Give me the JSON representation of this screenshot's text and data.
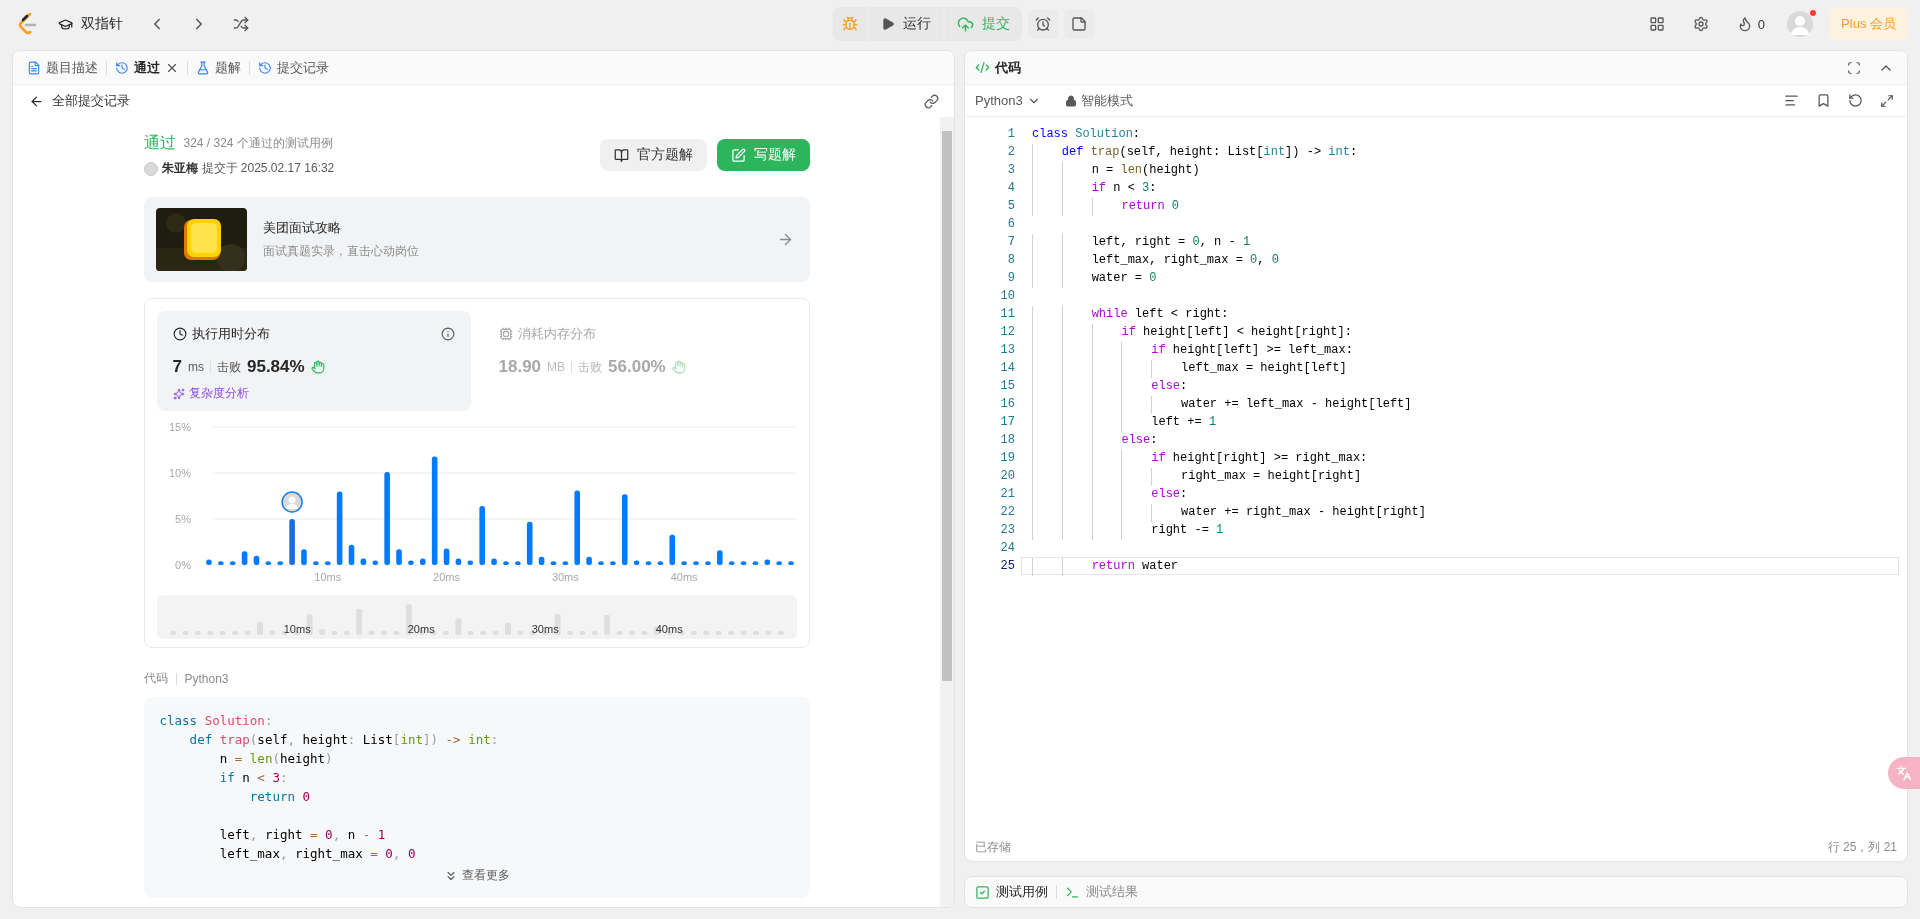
{
  "top_bar": {
    "problem": "双指针",
    "run": "运行",
    "submit": "提交",
    "fire_count": "0",
    "avatar_notification": true,
    "plus": "Plus 会员"
  },
  "left_tabs": [
    {
      "label": "题目描述",
      "kind": "doc",
      "selected": false,
      "closable": false
    },
    {
      "label": "通过",
      "kind": "history",
      "selected": true,
      "closable": true
    },
    {
      "label": "题解",
      "kind": "flask",
      "selected": false,
      "closable": false
    },
    {
      "label": "提交记录",
      "kind": "history",
      "selected": false,
      "closable": false
    }
  ],
  "back_link": "全部提交记录",
  "submission": {
    "status": "通过",
    "cases": "324 / 324 个通过的测试用例",
    "user": "朱亚梅",
    "submitted": "提交于 2025.02.17 16:32",
    "buttons": [
      {
        "label": "官方题解",
        "kind": "secondary"
      },
      {
        "label": "写题解",
        "kind": "primary"
      }
    ]
  },
  "promo": {
    "kind": "picture",
    "title": "美团面试攻略",
    "subtitle": "面试真题实录，直击心动岗位"
  },
  "stats": [
    {
      "kind": "time",
      "title": "执行用时分布",
      "selected": true,
      "value": "7",
      "unit": "ms",
      "beats_label": "击败",
      "beats": "95.84%",
      "extra": "复杂度分析"
    },
    {
      "kind": "memory",
      "title": "消耗内存分布",
      "selected": false,
      "value": "18.90",
      "unit": "MB",
      "beats_label": "击败",
      "beats": "56.00%"
    }
  ],
  "chart_data": {
    "type": "bar",
    "x": [
      0,
      1,
      2,
      3,
      4,
      5,
      6,
      7,
      8,
      9,
      10,
      11,
      12,
      13,
      14,
      15,
      16,
      17,
      18,
      19,
      20,
      21,
      22,
      23,
      24,
      25,
      26,
      27,
      28,
      29,
      30,
      31,
      32,
      33,
      34,
      35,
      36,
      37,
      38,
      39,
      40,
      41,
      42,
      43,
      44,
      45,
      46,
      47,
      48,
      49
    ],
    "values": [
      0.6,
      0.4,
      0.4,
      1.5,
      1.0,
      0.4,
      0.4,
      5.0,
      1.7,
      0.4,
      0.4,
      8.0,
      2.2,
      0.7,
      0.5,
      10.1,
      1.7,
      0.5,
      0.7,
      11.8,
      1.8,
      0.7,
      0.5,
      6.4,
      0.7,
      0.4,
      0.4,
      4.7,
      0.9,
      0.4,
      0.4,
      8.1,
      0.9,
      0.4,
      0.4,
      7.7,
      0.5,
      0.4,
      0.4,
      3.3,
      0.4,
      0.4,
      0.4,
      1.6,
      0.4,
      0.4,
      0.4,
      0.6,
      0.4,
      0.4
    ],
    "xlim": [
      -0.5,
      49.5
    ],
    "ylim": [
      0,
      15
    ],
    "yticks": [
      {
        "value": 0,
        "label": "0%"
      },
      {
        "value": 5,
        "label": "5%"
      },
      {
        "value": 10,
        "label": "10%"
      },
      {
        "value": 15,
        "label": "15%"
      }
    ],
    "xticks": [
      {
        "value": 10,
        "label": "10ms"
      },
      {
        "value": 20,
        "label": "20ms"
      },
      {
        "value": 30,
        "label": "30ms"
      },
      {
        "value": 40,
        "label": "40ms"
      }
    ]
  },
  "chart_overview": {
    "labels": [
      "10ms",
      "20ms",
      "30ms",
      "40ms"
    ]
  },
  "code_label": "代码",
  "code_lang": "Python3",
  "code_lines": [
    {
      "kind": "code",
      "tokens": [
        {
          "kind": "kw",
          "text": "class "
        },
        {
          "kind": "cls",
          "text": "Solution"
        },
        {
          "kind": "pu",
          "text": ":"
        }
      ]
    },
    {
      "kind": "code",
      "tokens": [
        {
          "kind": "kw",
          "text": "    def "
        },
        {
          "kind": "fn",
          "text": "trap"
        },
        {
          "kind": "pu",
          "text": "("
        },
        {
          "kind": "p",
          "text": "self"
        },
        {
          "kind": "pu",
          "text": ", "
        },
        {
          "kind": "p",
          "text": "height"
        },
        {
          "kind": "pu",
          "text": ": "
        },
        {
          "kind": "p",
          "text": "List"
        },
        {
          "kind": "pu",
          "text": "["
        },
        {
          "kind": "type",
          "text": "int"
        },
        {
          "kind": "pu",
          "text": "]) "
        },
        {
          "kind": "op",
          "text": "-> "
        },
        {
          "kind": "type",
          "text": "int"
        },
        {
          "kind": "pu",
          "text": ":"
        }
      ]
    },
    {
      "kind": "code",
      "tokens": [
        {
          "kind": "p",
          "text": "        n "
        },
        {
          "kind": "op",
          "text": "= "
        },
        {
          "kind": "call",
          "text": "len"
        },
        {
          "kind": "pu",
          "text": "("
        },
        {
          "kind": "p",
          "text": "height"
        },
        {
          "kind": "pu",
          "text": ")"
        }
      ]
    },
    {
      "kind": "code",
      "tokens": [
        {
          "kind": "ctl",
          "text": "        if "
        },
        {
          "kind": "p",
          "text": "n "
        },
        {
          "kind": "op",
          "text": "< "
        },
        {
          "kind": "num",
          "text": "3"
        },
        {
          "kind": "pu",
          "text": ":"
        }
      ]
    },
    {
      "kind": "code",
      "tokens": [
        {
          "kind": "ctl",
          "text": "            return "
        },
        {
          "kind": "num",
          "text": "0"
        }
      ]
    },
    {
      "kind": "blank"
    },
    {
      "kind": "code",
      "tokens": [
        {
          "kind": "p",
          "text": "        left"
        },
        {
          "kind": "pu",
          "text": ", "
        },
        {
          "kind": "p",
          "text": "right "
        },
        {
          "kind": "op",
          "text": "= "
        },
        {
          "kind": "num",
          "text": "0"
        },
        {
          "kind": "pu",
          "text": ", "
        },
        {
          "kind": "p",
          "text": "n "
        },
        {
          "kind": "op",
          "text": "- "
        },
        {
          "kind": "num",
          "text": "1"
        }
      ]
    },
    {
      "kind": "code",
      "tokens": [
        {
          "kind": "p",
          "text": "        left_max"
        },
        {
          "kind": "pu",
          "text": ", "
        },
        {
          "kind": "p",
          "text": "right_max "
        },
        {
          "kind": "op",
          "text": "= "
        },
        {
          "kind": "num",
          "text": "0"
        },
        {
          "kind": "pu",
          "text": ", "
        },
        {
          "kind": "num",
          "text": "0"
        }
      ]
    }
  ],
  "more": "查看更多",
  "editor": {
    "title": "代码",
    "language": "Python3",
    "mode": "智能模式",
    "saved": "已存储",
    "cursor": "行 25，列 21",
    "lines": [
      {
        "number": "1",
        "current": false,
        "kind": "code",
        "tokens": [
          {
            "kind": "kw",
            "text": "class "
          },
          {
            "kind": "cls",
            "text": "Solution"
          },
          {
            "kind": "pu",
            "text": ":"
          }
        ]
      },
      {
        "number": "2",
        "current": false,
        "kind": "code",
        "tokens": [
          {
            "kind": "kw",
            "text": "    def "
          },
          {
            "kind": "fn",
            "text": "trap"
          },
          {
            "kind": "pu",
            "text": "("
          },
          {
            "kind": "p",
            "text": "self"
          },
          {
            "kind": "pu",
            "text": ", "
          },
          {
            "kind": "p",
            "text": "height"
          },
          {
            "kind": "pu",
            "text": ": "
          },
          {
            "kind": "p",
            "text": "List"
          },
          {
            "kind": "pu",
            "text": "["
          },
          {
            "kind": "type",
            "text": "int"
          },
          {
            "kind": "pu",
            "text": "]) "
          },
          {
            "kind": "op",
            "text": "-> "
          },
          {
            "kind": "type",
            "text": "int"
          },
          {
            "kind": "pu",
            "text": ":"
          }
        ]
      },
      {
        "number": "3",
        "current": false,
        "kind": "code",
        "tokens": [
          {
            "kind": "p",
            "text": "        n "
          },
          {
            "kind": "op",
            "text": "= "
          },
          {
            "kind": "call",
            "text": "len"
          },
          {
            "kind": "pu",
            "text": "("
          },
          {
            "kind": "p",
            "text": "height"
          },
          {
            "kind": "pu",
            "text": ")"
          }
        ]
      },
      {
        "number": "4",
        "current": false,
        "kind": "code",
        "tokens": [
          {
            "kind": "ctl",
            "text": "        if "
          },
          {
            "kind": "p",
            "text": "n "
          },
          {
            "kind": "op",
            "text": "< "
          },
          {
            "kind": "num",
            "text": "3"
          },
          {
            "kind": "pu",
            "text": ":"
          }
        ]
      },
      {
        "number": "5",
        "current": false,
        "kind": "code",
        "tokens": [
          {
            "kind": "ctl",
            "text": "            return "
          },
          {
            "kind": "num",
            "text": "0"
          }
        ]
      },
      {
        "number": "6",
        "current": false,
        "kind": "blank"
      },
      {
        "number": "7",
        "current": false,
        "kind": "code",
        "tokens": [
          {
            "kind": "p",
            "text": "        left"
          },
          {
            "kind": "pu",
            "text": ", "
          },
          {
            "kind": "p",
            "text": "right "
          },
          {
            "kind": "op",
            "text": "= "
          },
          {
            "kind": "num",
            "text": "0"
          },
          {
            "kind": "pu",
            "text": ", "
          },
          {
            "kind": "p",
            "text": "n "
          },
          {
            "kind": "op",
            "text": "- "
          },
          {
            "kind": "num",
            "text": "1"
          }
        ]
      },
      {
        "number": "8",
        "current": false,
        "kind": "code",
        "tokens": [
          {
            "kind": "p",
            "text": "        left_max"
          },
          {
            "kind": "pu",
            "text": ", "
          },
          {
            "kind": "p",
            "text": "right_max "
          },
          {
            "kind": "op",
            "text": "= "
          },
          {
            "kind": "num",
            "text": "0"
          },
          {
            "kind": "pu",
            "text": ", "
          },
          {
            "kind": "num",
            "text": "0"
          }
        ]
      },
      {
        "number": "9",
        "current": false,
        "kind": "code",
        "tokens": [
          {
            "kind": "p",
            "text": "        water "
          },
          {
            "kind": "op",
            "text": "= "
          },
          {
            "kind": "num",
            "text": "0"
          }
        ]
      },
      {
        "number": "10",
        "current": false,
        "kind": "blank"
      },
      {
        "number": "11",
        "current": false,
        "kind": "code",
        "tokens": [
          {
            "kind": "ctl",
            "text": "        while "
          },
          {
            "kind": "p",
            "text": "left "
          },
          {
            "kind": "op",
            "text": "< "
          },
          {
            "kind": "p",
            "text": "right"
          },
          {
            "kind": "pu",
            "text": ":"
          }
        ]
      },
      {
        "number": "12",
        "current": false,
        "kind": "code",
        "tokens": [
          {
            "kind": "ctl",
            "text": "            if "
          },
          {
            "kind": "p",
            "text": "height[left] "
          },
          {
            "kind": "op",
            "text": "< "
          },
          {
            "kind": "p",
            "text": "height[right]"
          },
          {
            "kind": "pu",
            "text": ":"
          }
        ]
      },
      {
        "number": "13",
        "current": false,
        "kind": "code",
        "tokens": [
          {
            "kind": "ctl",
            "text": "                if "
          },
          {
            "kind": "p",
            "text": "height[left] "
          },
          {
            "kind": "op",
            "text": ">= "
          },
          {
            "kind": "p",
            "text": "left_max"
          },
          {
            "kind": "pu",
            "text": ":"
          }
        ]
      },
      {
        "number": "14",
        "current": false,
        "kind": "code",
        "tokens": [
          {
            "kind": "p",
            "text": "                    left_max "
          },
          {
            "kind": "op",
            "text": "= "
          },
          {
            "kind": "p",
            "text": "height[left]"
          }
        ]
      },
      {
        "number": "15",
        "current": false,
        "kind": "code",
        "tokens": [
          {
            "kind": "ctl",
            "text": "                else"
          },
          {
            "kind": "pu",
            "text": ":"
          }
        ]
      },
      {
        "number": "16",
        "current": false,
        "kind": "code",
        "tokens": [
          {
            "kind": "p",
            "text": "                    water "
          },
          {
            "kind": "op",
            "text": "+= "
          },
          {
            "kind": "p",
            "text": "left_max "
          },
          {
            "kind": "op",
            "text": "- "
          },
          {
            "kind": "p",
            "text": "height[left]"
          }
        ]
      },
      {
        "number": "17",
        "current": false,
        "kind": "code",
        "tokens": [
          {
            "kind": "p",
            "text": "                left "
          },
          {
            "kind": "op",
            "text": "+= "
          },
          {
            "kind": "num",
            "text": "1"
          }
        ]
      },
      {
        "number": "18",
        "current": false,
        "kind": "code",
        "tokens": [
          {
            "kind": "ctl",
            "text": "            else"
          },
          {
            "kind": "pu",
            "text": ":"
          }
        ]
      },
      {
        "number": "19",
        "current": false,
        "kind": "code",
        "tokens": [
          {
            "kind": "ctl",
            "text": "                if "
          },
          {
            "kind": "p",
            "text": "height[right] "
          },
          {
            "kind": "op",
            "text": ">= "
          },
          {
            "kind": "p",
            "text": "right_max"
          },
          {
            "kind": "pu",
            "text": ":"
          }
        ]
      },
      {
        "number": "20",
        "current": false,
        "kind": "code",
        "tokens": [
          {
            "kind": "p",
            "text": "                    right_max "
          },
          {
            "kind": "op",
            "text": "= "
          },
          {
            "kind": "p",
            "text": "height[right]"
          }
        ]
      },
      {
        "number": "21",
        "current": false,
        "kind": "code",
        "tokens": [
          {
            "kind": "ctl",
            "text": "                else"
          },
          {
            "kind": "pu",
            "text": ":"
          }
        ]
      },
      {
        "number": "22",
        "current": false,
        "kind": "code",
        "tokens": [
          {
            "kind": "p",
            "text": "                    water "
          },
          {
            "kind": "op",
            "text": "+= "
          },
          {
            "kind": "p",
            "text": "right_max "
          },
          {
            "kind": "op",
            "text": "- "
          },
          {
            "kind": "p",
            "text": "height[right]"
          }
        ]
      },
      {
        "number": "23",
        "current": false,
        "kind": "code",
        "tokens": [
          {
            "kind": "p",
            "text": "                right "
          },
          {
            "kind": "op",
            "text": "-= "
          },
          {
            "kind": "num",
            "text": "1"
          }
        ]
      },
      {
        "number": "24",
        "current": false,
        "kind": "blank"
      },
      {
        "number": "25",
        "current": true,
        "kind": "code",
        "tokens": [
          {
            "kind": "ctl",
            "text": "        return "
          },
          {
            "kind": "p",
            "text": "water"
          }
        ]
      }
    ]
  },
  "bottom_tabs": [
    {
      "label": "测试用例",
      "kind": "cases",
      "selected": true
    },
    {
      "label": "测试结果",
      "kind": "result",
      "selected": false
    }
  ]
}
